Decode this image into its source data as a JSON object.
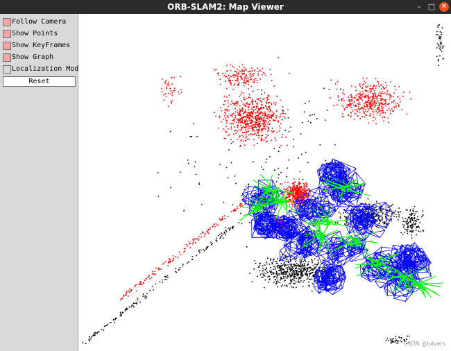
{
  "window": {
    "title": "ORB-SLAM2: Map Viewer",
    "minimize_glyph": "–",
    "maximize_glyph": "□",
    "close_glyph": "✕"
  },
  "panel": {
    "items": [
      {
        "label": "Follow Camera",
        "checked": true
      },
      {
        "label": "Show Points",
        "checked": true
      },
      {
        "label": "Show KeyFrames",
        "checked": true
      },
      {
        "label": "Show Graph",
        "checked": true
      },
      {
        "label": "Localization Mode",
        "checked": false
      }
    ],
    "reset_label": "Reset"
  },
  "viewer": {
    "watermark": "CSDN @Julyers",
    "colors": {
      "background": "#ffffff",
      "map_points": "#000000",
      "local_points": "#ff0000",
      "keyframes": "#0000ff",
      "graph": "#00ff00",
      "panel_checked": "#f4a6a6"
    }
  }
}
